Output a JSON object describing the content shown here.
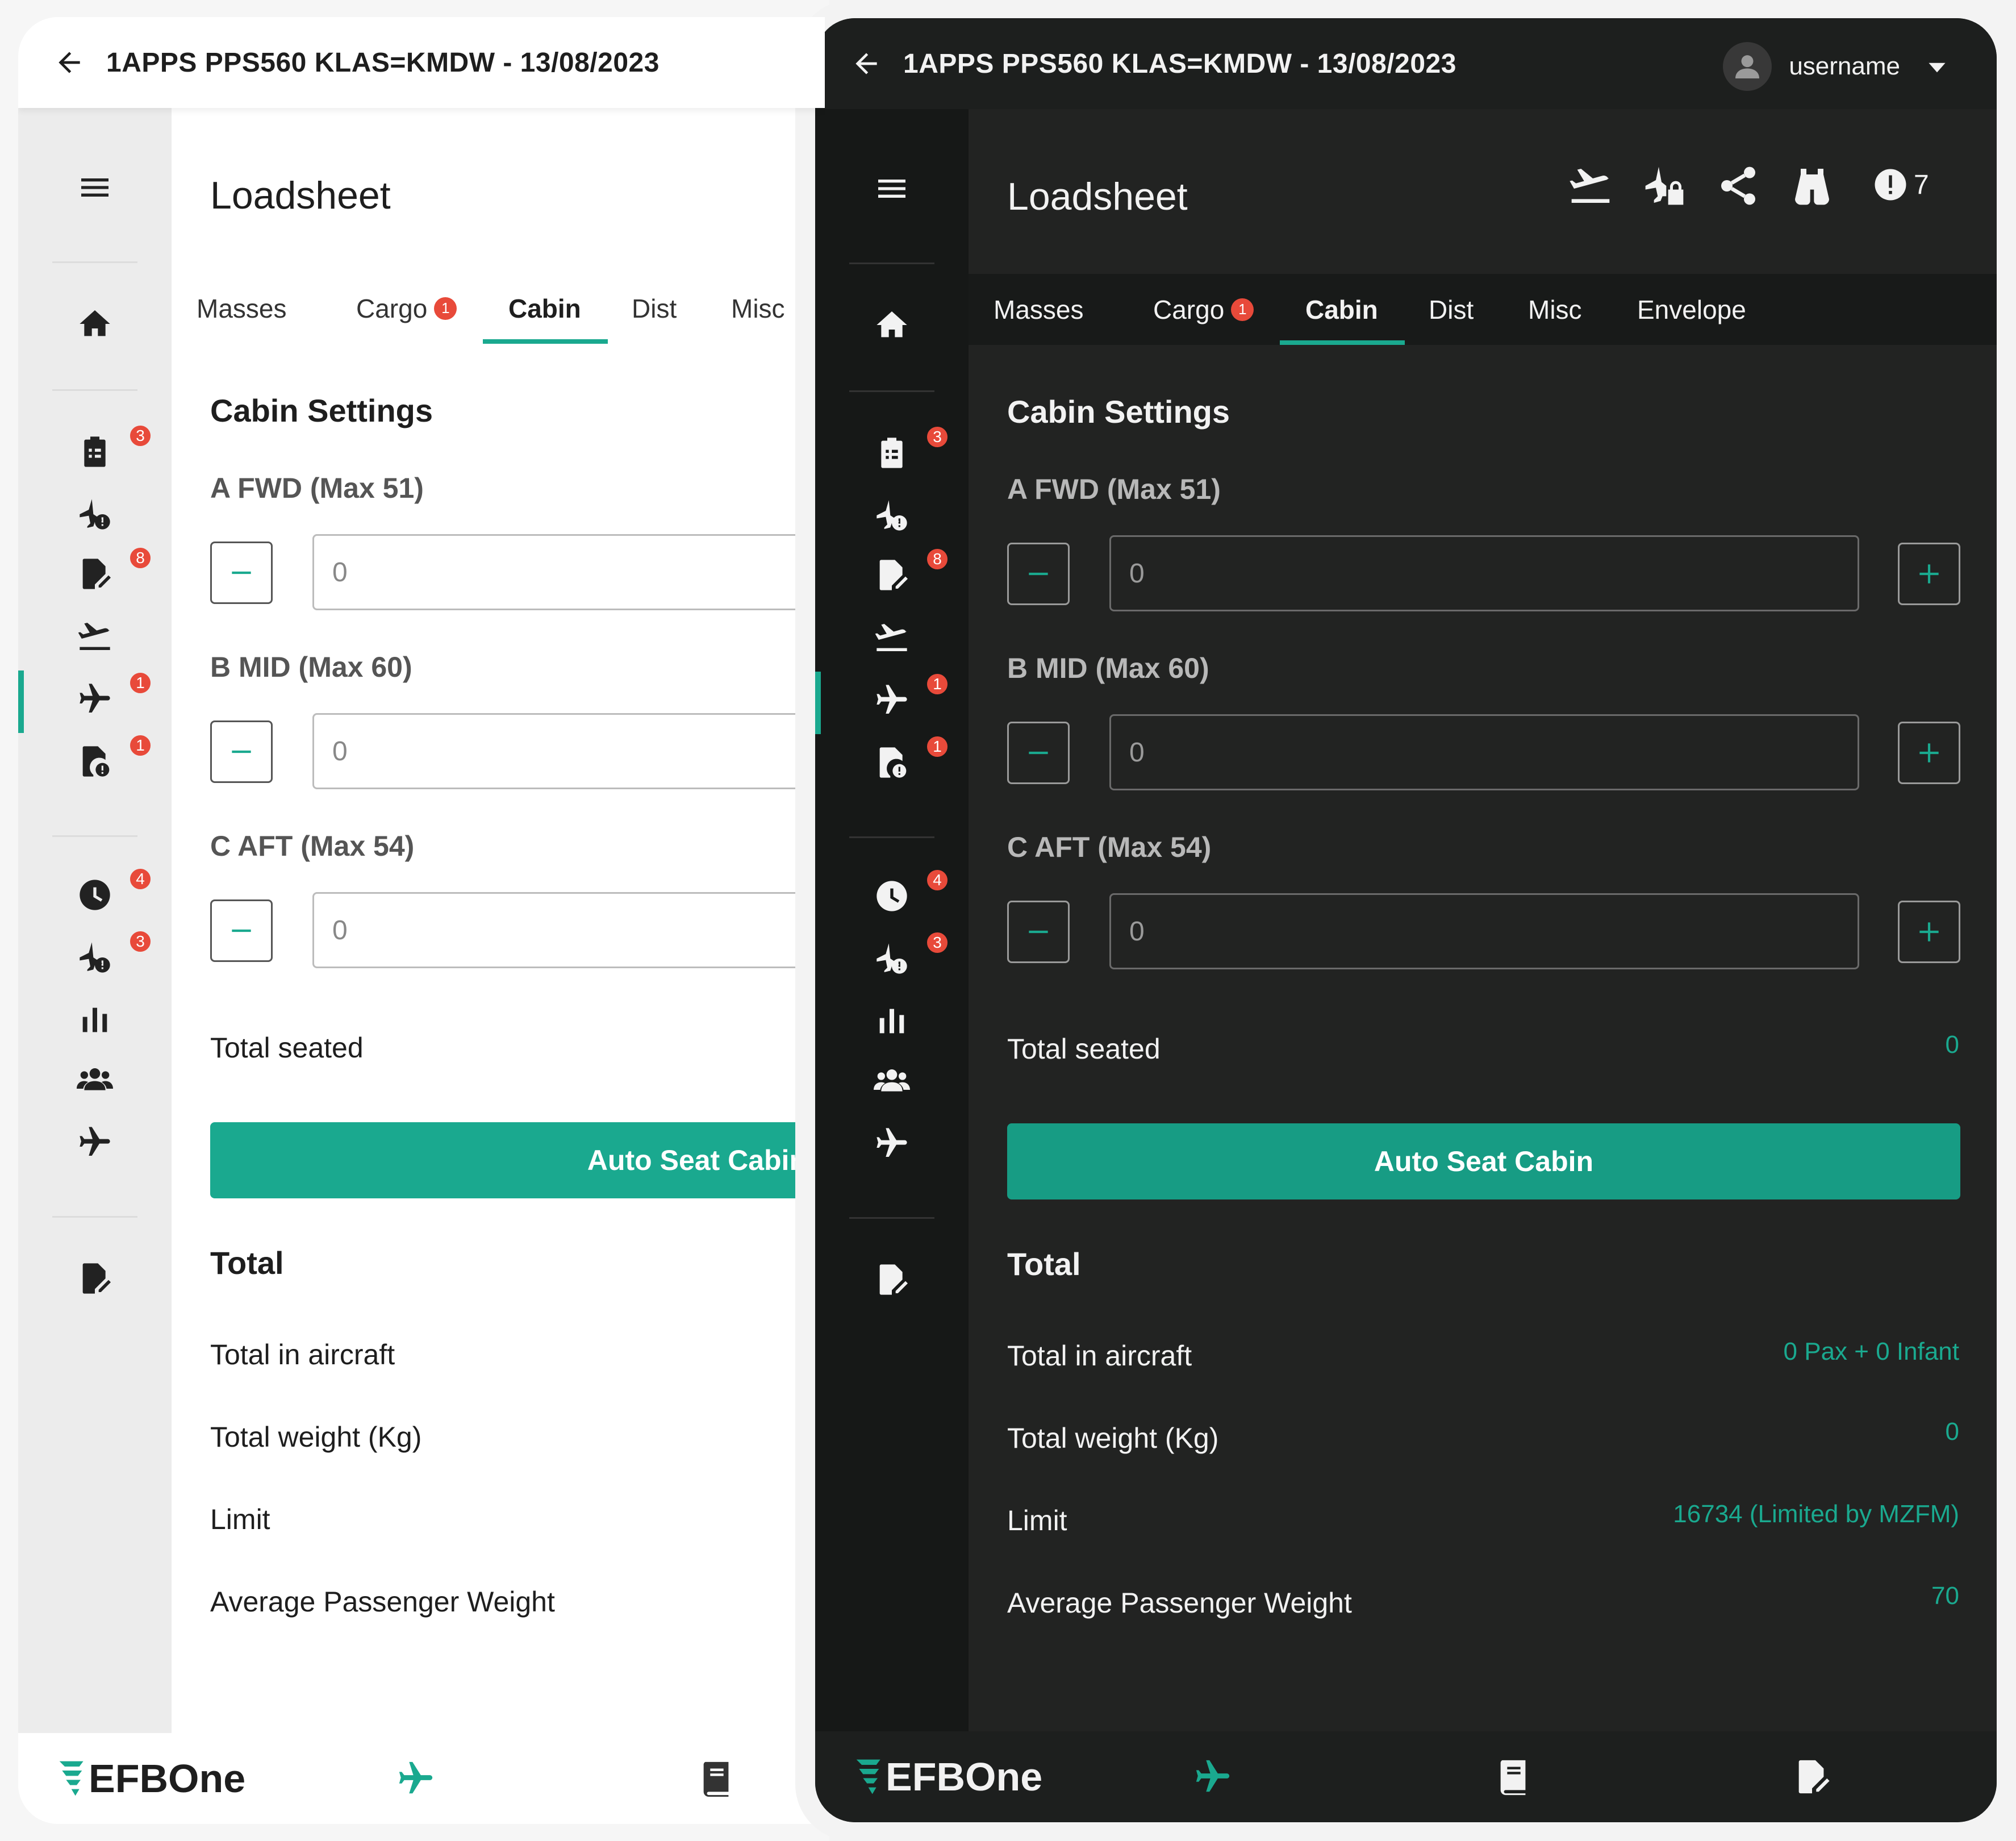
{
  "header": {
    "title": "1APPS PPS560 KLAS=KMDW - 13/08/2023",
    "username": "username"
  },
  "page": {
    "title": "Loadsheet"
  },
  "header_actions": {
    "alert_count": "7"
  },
  "tabs": [
    {
      "label": "Masses"
    },
    {
      "label": "Cargo",
      "badge": "1"
    },
    {
      "label": "Cabin"
    },
    {
      "label": "Dist"
    },
    {
      "label": "Misc"
    },
    {
      "label": "Envelope"
    }
  ],
  "sidebar": {
    "badges": {
      "checklist": "3",
      "flight_alert": "",
      "docs": "8",
      "flight": "1",
      "file_alert": "1",
      "clock": "4",
      "flight_alert2": "3"
    }
  },
  "cabin": {
    "section_title": "Cabin Settings",
    "fields": [
      {
        "label": "A FWD (Max 51)",
        "value": "0"
      },
      {
        "label": "B MID (Max 60)",
        "value": "0"
      },
      {
        "label": "C AFT (Max 54)",
        "value": "0"
      }
    ],
    "total_seated_label": "Total seated",
    "total_seated_value": "0",
    "auto_seat_label": "Auto Seat Cabin",
    "auto_seat_label_clipped": "Auto Seat Cabin"
  },
  "totals": {
    "section_title": "Total",
    "rows": [
      {
        "label": "Total in aircraft",
        "value": "0 Pax + 0 Infant"
      },
      {
        "label": "Total weight (Kg)",
        "value": "0"
      },
      {
        "label": "Limit",
        "value": "16734 (Limited by MZFM)"
      },
      {
        "label": "Average Passenger Weight",
        "value": "70"
      }
    ]
  },
  "footer": {
    "brand": "EFBOne"
  },
  "colors": {
    "accent": "#1aa98f",
    "badge": "#e84a3a",
    "dark_bg": "#222322",
    "dark_sidebar": "#161817",
    "light_sidebar": "#ececec"
  }
}
